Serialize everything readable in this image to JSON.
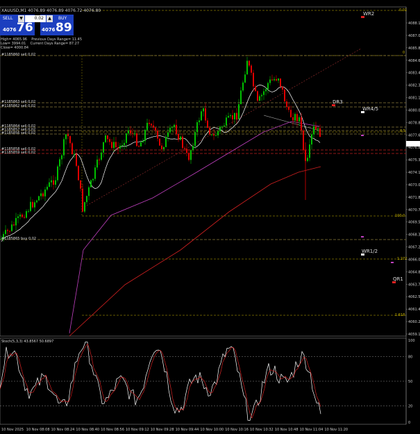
{
  "header": {
    "symbol_line": "XAUUSD,M1  4076.89  4076.89  4076.72  4076.80"
  },
  "trade_panel": {
    "sell_label": "SELL",
    "buy_label": "BUY",
    "lot": "0.02",
    "sell_small": "4076",
    "sell_big": "76",
    "buy_small": "4076",
    "buy_big": "89"
  },
  "info_box": {
    "line1": "High= 4065.96    Previous Days Range= 11.45",
    "line2": "Low= 3994.01    Current Days Range= 87.27",
    "line3": "Close= 4000.84"
  },
  "price_axis": {
    "labels": [
      "4088.15",
      "4087.00",
      "4085.85",
      "4084.60",
      "4083.45",
      "4082.30",
      "4081.15",
      "4080.00",
      "4078.85",
      "4077.65",
      "4076.80",
      "4075.35",
      "4074.15",
      "4073.00",
      "4071.85",
      "4070.70",
      "4069.50",
      "4068.35",
      "4067.20",
      "4066.00",
      "4064.85",
      "4063.70",
      "4062.55",
      "4061.40",
      "4060.25",
      "4059.10"
    ]
  },
  "fib_labels": {
    "top_small": "0.01",
    "zero": "0",
    "f05": "0.5",
    "hundred": "100.0",
    "f1272": "1.272",
    "f1618": "1.618"
  },
  "pivots": {
    "wr2": "WR2",
    "dr3": "DR3",
    "wr45": "WR4/5",
    "wr12": "WR1/2",
    "qr1": "QR1"
  },
  "order_labels": {
    "o1": "#1185860 sell 0.02",
    "o2": "#1185863 sell 0.02",
    "o3": "#1185862 sell 0.02",
    "o4": "#1185864 sell 0.02",
    "o5": "#1185857 sell 0.02",
    "o6": "#1185856 sell 0.02",
    "o7": "#1185858 sell 0.02",
    "o8": "#1185859 sell 0.02",
    "o9": "#1185865 buy 0.02"
  },
  "stoch": {
    "title": "Stoch(5,3,3) 43.8567 50.6897",
    "levels": [
      "100",
      "80",
      "50",
      "20",
      "0"
    ]
  },
  "time_axis": {
    "labels": [
      "10 Nov 2025",
      "10 Nov 08:08",
      "10 Nov 08:24",
      "10 Nov 08:40",
      "10 Nov 08:56",
      "10 Nov 09:12",
      "10 Nov 09:28",
      "10 Nov 09:44",
      "10 Nov 10:00",
      "10 Nov 10:16",
      "10 Nov 10:32",
      "10 Nov 10:48",
      "10 Nov 11:04",
      "10 Nov 11:20"
    ]
  },
  "colors": {
    "bull": "#00c000",
    "bear": "#e00000",
    "ma_fast": "#ffffff",
    "ma_mid": "#c040c0",
    "ma_slow": "#d02020",
    "fib": "#c8b400",
    "grid_price": "#3060c0"
  }
}
